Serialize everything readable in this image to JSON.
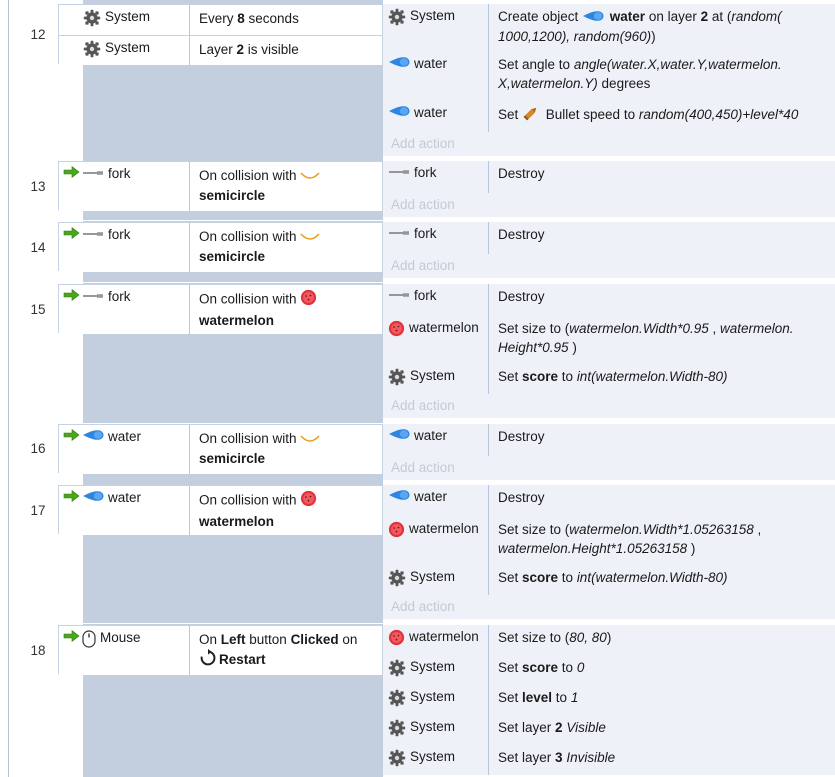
{
  "events": [
    {
      "number": "12",
      "conditions": [
        {
          "object": "System",
          "icon": "gear-icon",
          "parts": [
            {
              "t": "Every "
            },
            {
              "t": "8",
              "b": true
            },
            {
              "t": " seconds"
            }
          ]
        },
        {
          "object": "System",
          "icon": "gear-icon",
          "parts": [
            {
              "t": "Layer "
            },
            {
              "t": "2",
              "b": true
            },
            {
              "t": " is visible"
            }
          ]
        }
      ],
      "actions": [
        {
          "object": "System",
          "icon": "gear-icon",
          "lines": [
            [
              {
                "t": "Create object "
              },
              {
                "icon": "water-drop-icon"
              },
              {
                "t": " water",
                "b": true
              },
              {
                "t": " on layer "
              },
              {
                "t": "2",
                "b": true
              },
              {
                "t": " at ("
              },
              {
                "t": "random(",
                "i": true
              }
            ],
            [
              {
                "t": "1000,1200), random(960)",
                "i": true
              },
              {
                "t": ")"
              }
            ]
          ]
        },
        {
          "object": "water",
          "icon": "water-drop-icon",
          "lines": [
            [
              {
                "t": "Set angle to "
              },
              {
                "t": "angle(water.X,water.Y,watermelon.",
                "i": true
              }
            ],
            [
              {
                "t": "X,watermelon.Y)",
                "i": true
              },
              {
                "t": "  degrees"
              }
            ]
          ]
        },
        {
          "object": "water",
          "icon": "water-drop-icon",
          "lines": [
            [
              {
                "t": "Set "
              },
              {
                "icon": "bullet-icon"
              },
              {
                "t": " Bullet speed to "
              },
              {
                "t": "random(400,450)+level*40",
                "i": true
              }
            ]
          ]
        }
      ],
      "add_action": "Add action"
    },
    {
      "number": "13",
      "trigger": true,
      "conditions": [
        {
          "object": "fork",
          "icon": "fork-icon",
          "lines": [
            [
              {
                "t": "On collision with "
              },
              {
                "icon": "semicircle-icon"
              }
            ],
            [
              {
                "t": "semicircle",
                "b": true
              }
            ]
          ]
        }
      ],
      "actions": [
        {
          "object": "fork",
          "icon": "fork-icon",
          "lines": [
            [
              {
                "t": "Destroy"
              }
            ]
          ]
        }
      ],
      "add_action": "Add action"
    },
    {
      "number": "14",
      "trigger": true,
      "conditions": [
        {
          "object": "fork",
          "icon": "fork-icon",
          "lines": [
            [
              {
                "t": "On collision with "
              },
              {
                "icon": "semicircle-icon"
              }
            ],
            [
              {
                "t": "semicircle",
                "b": true
              }
            ]
          ]
        }
      ],
      "actions": [
        {
          "object": "fork",
          "icon": "fork-icon",
          "lines": [
            [
              {
                "t": "Destroy"
              }
            ]
          ]
        }
      ],
      "add_action": "Add action"
    },
    {
      "number": "15",
      "trigger": true,
      "conditions": [
        {
          "object": "fork",
          "icon": "fork-icon",
          "lines": [
            [
              {
                "t": "On collision with "
              },
              {
                "icon": "watermelon-icon"
              }
            ],
            [
              {
                "t": "watermelon",
                "b": true
              }
            ]
          ]
        }
      ],
      "actions": [
        {
          "object": "fork",
          "icon": "fork-icon",
          "lines": [
            [
              {
                "t": "Destroy"
              }
            ]
          ]
        },
        {
          "object": "watermelon",
          "icon": "watermelon-icon",
          "lines": [
            [
              {
                "t": "Set size to ("
              },
              {
                "t": "watermelon.Width*0.95",
                "i": true
              },
              {
                "t": " , "
              },
              {
                "t": "watermelon.",
                "i": true
              }
            ],
            [
              {
                "t": "Height*0.95",
                "i": true
              },
              {
                "t": " )"
              }
            ]
          ]
        },
        {
          "object": "System",
          "icon": "gear-icon",
          "lines": [
            [
              {
                "t": "Set "
              },
              {
                "t": "score",
                "b": true
              },
              {
                "t": " to "
              },
              {
                "t": "int(watermelon.Width-80)",
                "i": true
              }
            ]
          ]
        }
      ],
      "add_action": "Add action"
    },
    {
      "number": "16",
      "trigger": true,
      "conditions": [
        {
          "object": "water",
          "icon": "water-drop-icon",
          "lines": [
            [
              {
                "t": "On collision with "
              },
              {
                "icon": "semicircle-icon"
              }
            ],
            [
              {
                "t": "semicircle",
                "b": true
              }
            ]
          ]
        }
      ],
      "actions": [
        {
          "object": "water",
          "icon": "water-drop-icon",
          "lines": [
            [
              {
                "t": "Destroy"
              }
            ]
          ]
        }
      ],
      "add_action": "Add action"
    },
    {
      "number": "17",
      "trigger": true,
      "conditions": [
        {
          "object": "water",
          "icon": "water-drop-icon",
          "lines": [
            [
              {
                "t": "On collision with "
              },
              {
                "icon": "watermelon-icon"
              }
            ],
            [
              {
                "t": "watermelon",
                "b": true
              }
            ]
          ]
        }
      ],
      "actions": [
        {
          "object": "water",
          "icon": "water-drop-icon",
          "lines": [
            [
              {
                "t": "Destroy"
              }
            ]
          ]
        },
        {
          "object": "watermelon",
          "icon": "watermelon-icon",
          "lines": [
            [
              {
                "t": "Set size to ("
              },
              {
                "t": "watermelon.Width*1.05263158",
                "i": true
              },
              {
                "t": " ,"
              }
            ],
            [
              {
                "t": "watermelon.Height*1.05263158",
                "i": true
              },
              {
                "t": " )"
              }
            ]
          ]
        },
        {
          "object": "System",
          "icon": "gear-icon",
          "lines": [
            [
              {
                "t": "Set "
              },
              {
                "t": "score",
                "b": true
              },
              {
                "t": " to "
              },
              {
                "t": "int(watermelon.Width-80)",
                "i": true
              }
            ]
          ]
        }
      ],
      "add_action": "Add action"
    },
    {
      "number": "18",
      "trigger": true,
      "conditions": [
        {
          "object": "Mouse",
          "icon": "mouse-icon",
          "lines": [
            [
              {
                "t": "On "
              },
              {
                "t": "Left",
                "b": true
              },
              {
                "t": " button "
              },
              {
                "t": "Clicked",
                "b": true
              },
              {
                "t": " on"
              }
            ],
            [
              {
                "icon": "restart-icon"
              },
              {
                "t": "Restart",
                "b": true
              }
            ]
          ]
        }
      ],
      "actions": [
        {
          "object": "watermelon",
          "icon": "watermelon-icon",
          "lines": [
            [
              {
                "t": "Set size to ("
              },
              {
                "t": "80, 80",
                "i": true
              },
              {
                "t": ")"
              }
            ]
          ]
        },
        {
          "object": "System",
          "icon": "gear-icon",
          "lines": [
            [
              {
                "t": "Set "
              },
              {
                "t": "score",
                "b": true
              },
              {
                "t": " to "
              },
              {
                "t": "0",
                "i": true
              }
            ]
          ]
        },
        {
          "object": "System",
          "icon": "gear-icon",
          "lines": [
            [
              {
                "t": "Set "
              },
              {
                "t": "level",
                "b": true
              },
              {
                "t": " to "
              },
              {
                "t": "1",
                "i": true
              }
            ]
          ]
        },
        {
          "object": "System",
          "icon": "gear-icon",
          "lines": [
            [
              {
                "t": "Set layer "
              },
              {
                "t": "2",
                "b": true
              },
              {
                "t": " "
              },
              {
                "t": "Visible",
                "i": true
              }
            ]
          ]
        },
        {
          "object": "System",
          "icon": "gear-icon",
          "lines": [
            [
              {
                "t": "Set layer "
              },
              {
                "t": "3",
                "b": true
              },
              {
                "t": " "
              },
              {
                "t": "Invisible",
                "i": true
              }
            ]
          ]
        }
      ]
    }
  ],
  "colors": {
    "block_bg": "#c3cfdf",
    "action_bg": "#eef2f8",
    "add_action_text": "#c2cad6",
    "trigger_arrow": "#4aa61c"
  }
}
